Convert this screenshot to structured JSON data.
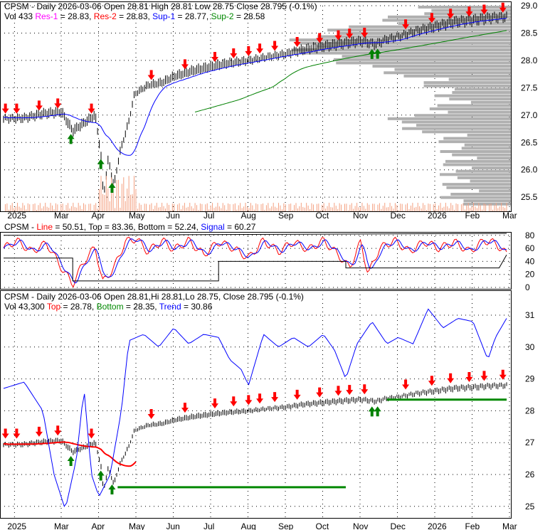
{
  "panel1": {
    "title": "CPSM - Daily 2026-03-06 Open 28.81  High 28.81  Low 28.75  Close 28.795 (-0.1%)",
    "vol": "Vol 433",
    "res1_label": "Res-1",
    "res1": " = 28.83, ",
    "res2_label": "Res-2",
    "res2": " = 28.83, ",
    "sup1_label": "Sup-1",
    "sup1": " = 28.77, ",
    "sup2_label": "Sup-2",
    "sup2": " = 28.58"
  },
  "panel2": {
    "prefix": "CPSM - ",
    "line_label": "Line",
    "line": " = 50.51, Top = 83.36, Bottom = 52.24, ",
    "signal_label": "Signal",
    "signal": " = 60.27"
  },
  "panel3": {
    "title": "CPSM - Daily 2026-03-06 Open 28.81,Hi 28.81,Lo 28.75, Close 28.795 (-0.1%)",
    "vol": "Vol 43,300 ",
    "top_label": "Top",
    "top": " = 28.78, ",
    "bottom_label": "Bottom",
    "bottom": " = 28.35, ",
    "trend_label": "Trend",
    "trend": " = 30.86"
  },
  "colors": {
    "up": "#008000",
    "down": "#ff0000",
    "ma": "#0000ff",
    "ma_long": "#008000",
    "grid": "#000000",
    "profile": "#b0b0b0"
  },
  "chart_data": {
    "type": "line",
    "x_labels": [
      {
        "m": 0.75,
        "t": "2025"
      },
      {
        "m": 2,
        "t": "Mar"
      },
      {
        "m": 3,
        "t": "Apr"
      },
      {
        "m": 4,
        "t": "May"
      },
      {
        "m": 5,
        "t": "Jun"
      },
      {
        "m": 6,
        "t": "Jul"
      },
      {
        "m": 7,
        "t": "Aug"
      },
      {
        "m": 8,
        "t": "Sep"
      },
      {
        "m": 9,
        "t": "Oct"
      },
      {
        "m": 10,
        "t": "Nov"
      },
      {
        "m": 11,
        "t": "Dec"
      },
      {
        "m": 12,
        "t": "2026"
      },
      {
        "m": 13,
        "t": "Feb"
      },
      {
        "m": 14,
        "t": "Mar"
      }
    ],
    "price_y_ticks": [
      "29.0",
      "28.5",
      "28.0",
      "27.5",
      "27.0",
      "26.5",
      "26.0",
      "25.5"
    ],
    "osc_y_ticks": [
      "80",
      "60",
      "40",
      "20",
      "0"
    ],
    "trend_y_ticks": [
      "31",
      "30",
      "29",
      "28",
      "27",
      "26",
      "25"
    ],
    "price": [
      [
        0.45,
        26.95
      ],
      [
        1.0,
        26.95
      ],
      [
        1.5,
        27.02
      ],
      [
        2.0,
        27.05
      ],
      [
        2.3,
        26.7
      ],
      [
        2.6,
        26.85
      ],
      [
        2.9,
        27.0
      ],
      [
        3.05,
        26.3
      ],
      [
        3.12,
        25.5
      ],
      [
        3.25,
        26.2
      ],
      [
        3.4,
        25.7
      ],
      [
        3.55,
        26.3
      ],
      [
        3.8,
        26.9
      ],
      [
        3.95,
        27.4
      ],
      [
        4.3,
        27.55
      ],
      [
        4.7,
        27.6
      ],
      [
        5.0,
        27.7
      ],
      [
        5.5,
        27.8
      ],
      [
        6.0,
        27.88
      ],
      [
        6.5,
        27.95
      ],
      [
        7.0,
        28.0
      ],
      [
        7.5,
        28.08
      ],
      [
        8.0,
        28.12
      ],
      [
        8.5,
        28.2
      ],
      [
        9.0,
        28.25
      ],
      [
        9.5,
        28.3
      ],
      [
        10.0,
        28.35
      ],
      [
        10.4,
        28.3
      ],
      [
        10.7,
        28.4
      ],
      [
        11.0,
        28.45
      ],
      [
        11.5,
        28.55
      ],
      [
        12.0,
        28.62
      ],
      [
        12.5,
        28.7
      ],
      [
        13.0,
        28.73
      ],
      [
        13.5,
        28.78
      ],
      [
        13.9,
        28.8
      ]
    ],
    "oscillator": [
      [
        0.45,
        60
      ],
      [
        0.8,
        72
      ],
      [
        1.2,
        55
      ],
      [
        1.6,
        68
      ],
      [
        2.0,
        30
      ],
      [
        2.3,
        5
      ],
      [
        2.6,
        40
      ],
      [
        2.9,
        62
      ],
      [
        3.1,
        8
      ],
      [
        3.4,
        30
      ],
      [
        3.7,
        70
      ],
      [
        4.0,
        75
      ],
      [
        4.3,
        55
      ],
      [
        4.7,
        72
      ],
      [
        5.0,
        58
      ],
      [
        5.4,
        72
      ],
      [
        5.8,
        50
      ],
      [
        6.2,
        70
      ],
      [
        6.6,
        60
      ],
      [
        7.0,
        45
      ],
      [
        7.4,
        72
      ],
      [
        7.8,
        55
      ],
      [
        8.2,
        70
      ],
      [
        8.6,
        58
      ],
      [
        9.0,
        72
      ],
      [
        9.4,
        50
      ],
      [
        9.7,
        30
      ],
      [
        10.0,
        70
      ],
      [
        10.2,
        20
      ],
      [
        10.5,
        60
      ],
      [
        10.9,
        72
      ],
      [
        11.3,
        55
      ],
      [
        11.7,
        70
      ],
      [
        12.1,
        60
      ],
      [
        12.5,
        70
      ],
      [
        12.9,
        55
      ],
      [
        13.3,
        72
      ],
      [
        13.6,
        68
      ],
      [
        13.9,
        51
      ]
    ],
    "trend": [
      [
        0.45,
        28.7
      ],
      [
        1,
        28.9
      ],
      [
        1.5,
        28.0
      ],
      [
        1.8,
        26
      ],
      [
        2.1,
        24.9
      ],
      [
        2.4,
        26.5
      ],
      [
        2.6,
        28.7
      ],
      [
        2.8,
        26
      ],
      [
        3.0,
        25.3
      ],
      [
        3.3,
        26
      ],
      [
        3.6,
        28
      ],
      [
        3.8,
        30.2
      ],
      [
        4.2,
        30.4
      ],
      [
        4.6,
        30.0
      ],
      [
        5.0,
        30.6
      ],
      [
        5.4,
        30.1
      ],
      [
        5.8,
        30.4
      ],
      [
        6.2,
        30.3
      ],
      [
        6.5,
        29.6
      ],
      [
        6.8,
        29.3
      ],
      [
        7.0,
        28.8
      ],
      [
        7.4,
        30.4
      ],
      [
        7.8,
        30.0
      ],
      [
        8.2,
        30.3
      ],
      [
        8.6,
        30.0
      ],
      [
        9.0,
        30.4
      ],
      [
        9.3,
        29.9
      ],
      [
        9.6,
        29.0
      ],
      [
        9.9,
        30.1
      ],
      [
        10.3,
        30.8
      ],
      [
        10.7,
        30.1
      ],
      [
        11.0,
        30.3
      ],
      [
        11.4,
        30.1
      ],
      [
        11.8,
        31.2
      ],
      [
        12.2,
        30.6
      ],
      [
        12.6,
        30.9
      ],
      [
        13.0,
        30.8
      ],
      [
        13.4,
        29.6
      ],
      [
        13.6,
        30.3
      ],
      [
        13.9,
        30.9
      ]
    ],
    "sell_signals_m": [
      0.5,
      0.8,
      1.4,
      1.9,
      2.8,
      4.4,
      5.3,
      6.1,
      6.6,
      7.0,
      7.3,
      7.7,
      8.3,
      8.9,
      9.4,
      9.7,
      10.1,
      11.2,
      11.9,
      12.4,
      12.9,
      13.3,
      13.8
    ],
    "buy_signals_m": [
      2.25,
      3.05,
      3.35,
      10.3,
      10.45
    ]
  }
}
